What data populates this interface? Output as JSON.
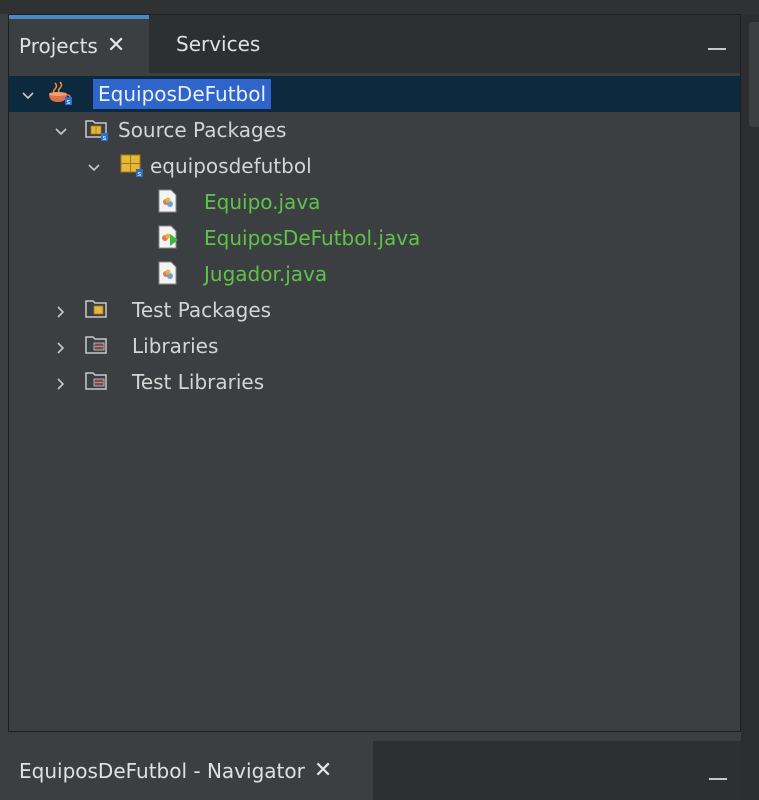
{
  "tabs": {
    "projects_label": "Projects",
    "services_label": "Services"
  },
  "tree": {
    "project": "EquiposDeFutbol",
    "source_packages": "Source Packages",
    "package": "equiposdefutbol",
    "files": [
      "Equipo.java",
      "EquiposDeFutbol.java",
      "Jugador.java"
    ],
    "test_packages": "Test Packages",
    "libraries": "Libraries",
    "test_libraries": "Test Libraries"
  },
  "navigator": {
    "tab_label": "EquiposDeFutbol - Navigator"
  },
  "colors": {
    "background": "#3c3f41",
    "selection": "#2f65ca",
    "modified_file": "#5fc34a",
    "active_tab_accent": "#4a88c7"
  },
  "icons": [
    "project-icon",
    "source-packages-icon",
    "package-icon",
    "java-file-icon",
    "java-main-file-icon",
    "test-packages-icon",
    "libraries-icon",
    "test-libraries-icon"
  ]
}
